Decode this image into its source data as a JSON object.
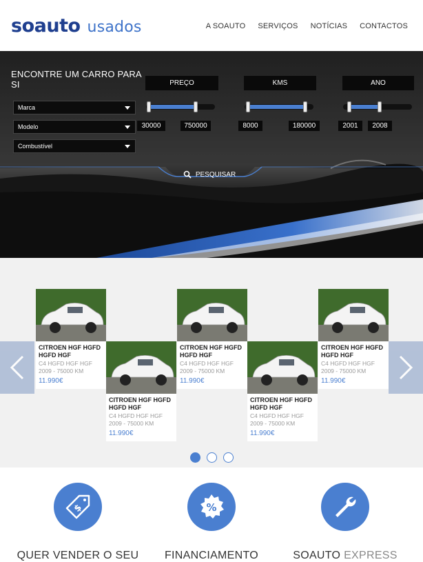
{
  "brand": {
    "main": "SOAUTO",
    "sub": "usados"
  },
  "nav": [
    {
      "label": "A SOAUTO"
    },
    {
      "label": "SERVIÇOS"
    },
    {
      "label": "NOTÍCIAS"
    },
    {
      "label": "CONTACTOS"
    }
  ],
  "search": {
    "title": "ENCONTRE UM CARRO PARA SI",
    "dropdowns": [
      "Marca",
      "Modelo",
      "Combustível"
    ],
    "ranges": [
      {
        "label": "PREÇO",
        "min": "30000",
        "max": "750000"
      },
      {
        "label": "KMS",
        "min": "8000",
        "max": "180000"
      },
      {
        "label": "ANO",
        "min": "2001",
        "max": "2008"
      }
    ],
    "button_label": "PESQUISAR"
  },
  "cars": [
    {
      "title": "CITROEN HGF HGFD HGFD HGF",
      "sub1": "C4 HGFD HGF HGF",
      "sub2": "2009 - 75000 KM",
      "price": "11.990€"
    },
    {
      "title": "CITROEN HGF HGFD HGFD HGF",
      "sub1": "C4 HGFD HGF HGF",
      "sub2": "2009 - 75000 KM",
      "price": "11.990€"
    },
    {
      "title": "CITROEN HGF HGFD HGFD HGF",
      "sub1": "C4 HGFD HGF HGF",
      "sub2": "2009 - 75000 KM",
      "price": "11.990€"
    },
    {
      "title": "CITROEN HGF HGFD HGFD HGF",
      "sub1": "C4 HGFD HGF HGF",
      "sub2": "2009 - 75000 KM",
      "price": "11.990€"
    },
    {
      "title": "CITROEN HGF HGFD HGFD HGF",
      "sub1": "C4 HGFD HGF HGF",
      "sub2": "2009 - 75000 KM",
      "price": "11.990€"
    }
  ],
  "carousel": {
    "pages": 3,
    "active_page": 1,
    "prev_icon": "chevron-left-icon",
    "next_icon": "chevron-right-icon"
  },
  "services": [
    {
      "label": "QUER VENDER O SEU",
      "label_light": "",
      "icon": "price-tag-icon"
    },
    {
      "label": "FINANCIAMENTO",
      "label_light": "",
      "icon": "percent-badge-icon"
    },
    {
      "label": "SOAUTO",
      "label_light": "EXPRESS",
      "icon": "wrench-icon"
    }
  ],
  "colors": {
    "brand_dark": "#1f3f8f",
    "accent": "#4a7fd0",
    "hero_dark": "#0a0a0a"
  }
}
